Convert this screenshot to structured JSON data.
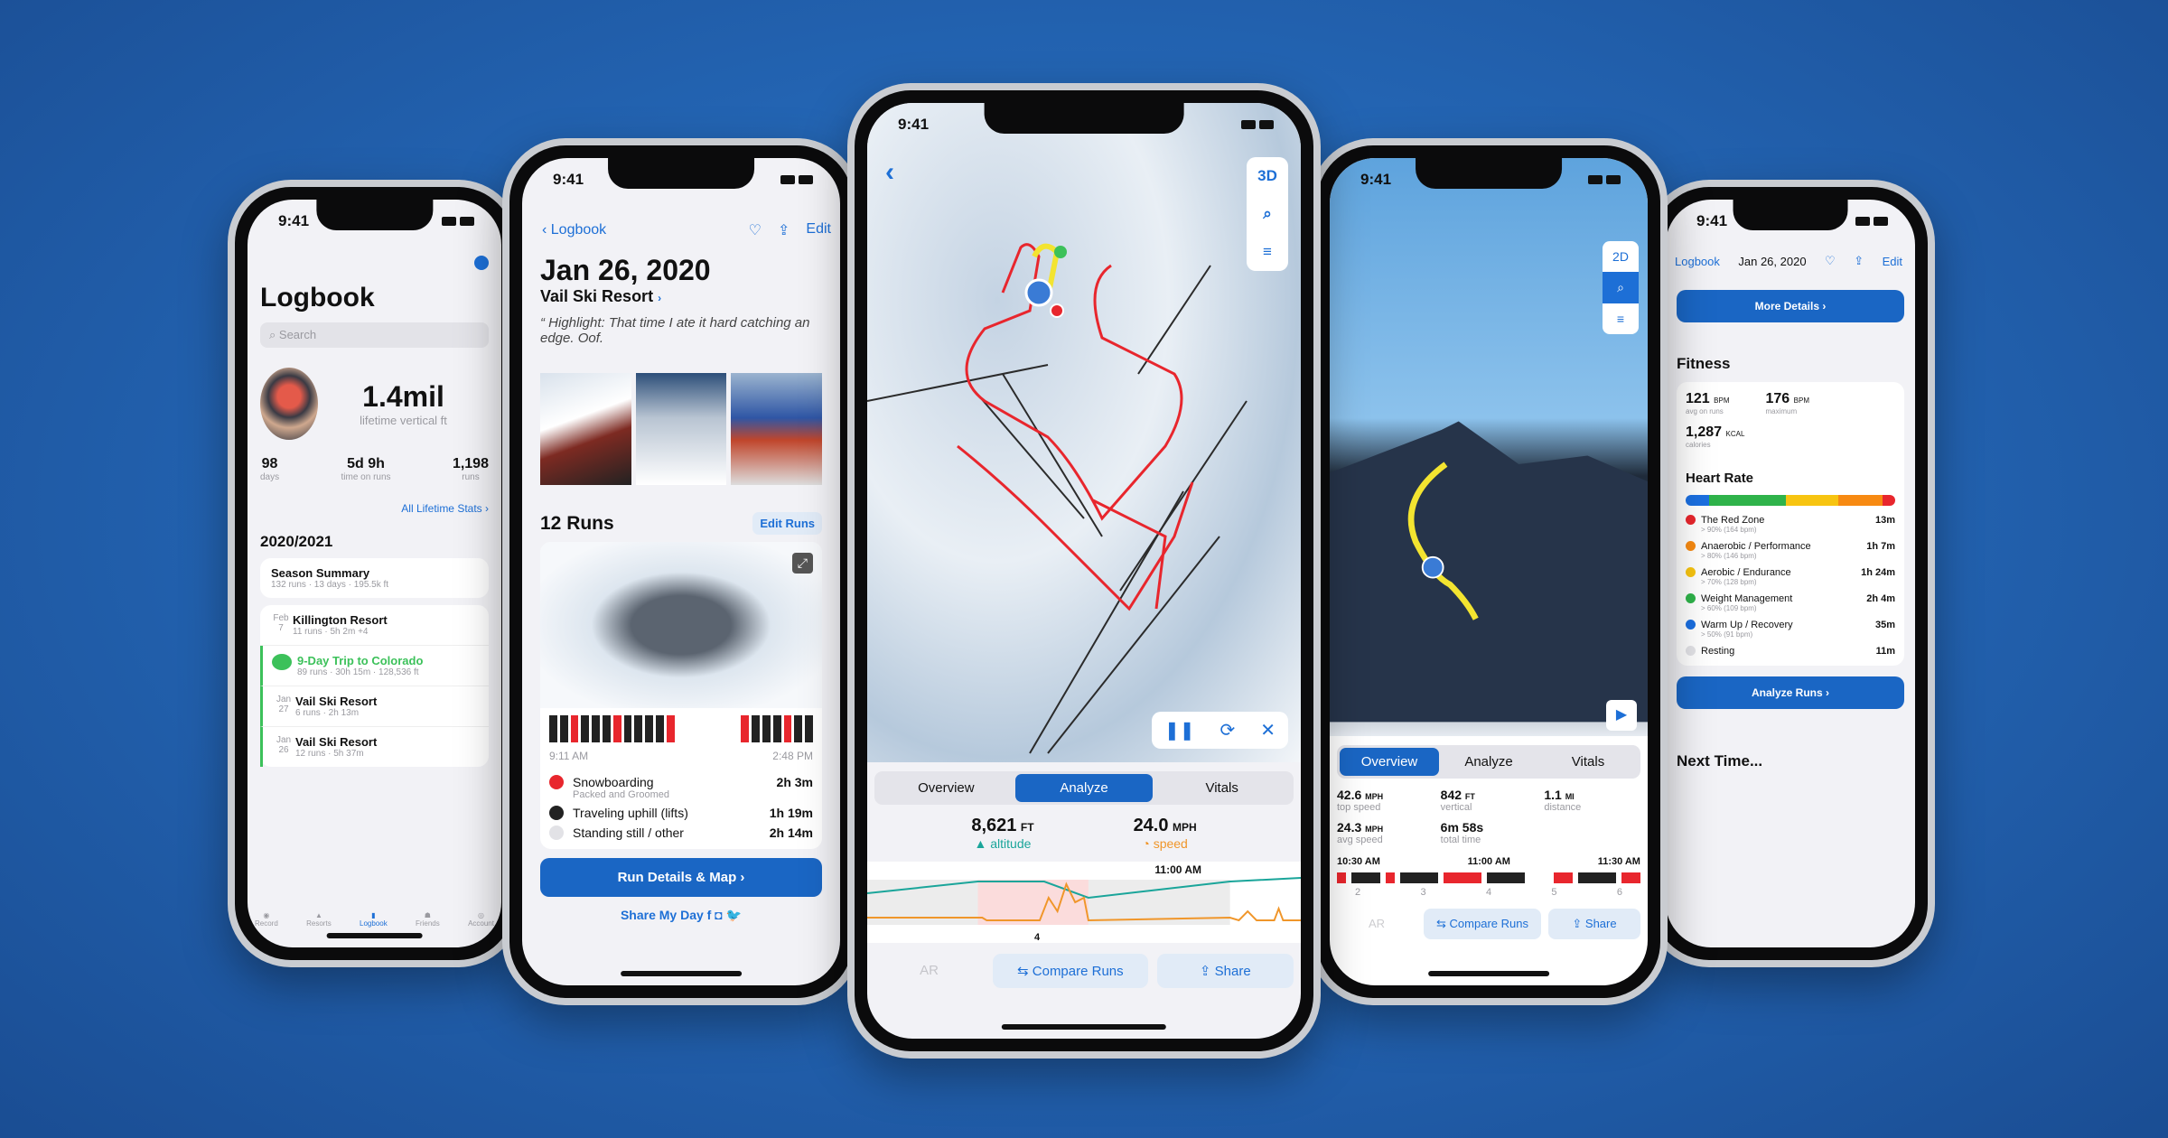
{
  "status_time": "9:41",
  "colors": {
    "accent": "#1a66c4",
    "run_red": "#e8262d",
    "altitude": "#1aa59a",
    "speed": "#f0962a",
    "trip_green": "#3cc15a"
  },
  "logbook": {
    "title": "Logbook",
    "search_placeholder": "Search",
    "lifetime_vertical": "1.4mil",
    "lifetime_vertical_label": "lifetime vertical ft",
    "stats": [
      {
        "value": "98",
        "label": "days"
      },
      {
        "value": "5d 9h",
        "label": "time on runs"
      },
      {
        "value": "1,198",
        "label": "runs"
      }
    ],
    "all_stats_link": "All Lifetime Stats ›",
    "season": "2020/2021",
    "season_summary": {
      "title": "Season Summary",
      "sub": "132 runs · 13 days · 195.5k ft"
    },
    "items": [
      {
        "month": "Feb",
        "day": "7",
        "title": "Killington Resort",
        "sub": "11 runs · 5h 2m",
        "extra": "+4"
      },
      {
        "month": "",
        "day": "",
        "title": "9-Day Trip to Colorado",
        "sub": "89 runs · 30h 15m · 128,536 ft",
        "extra": ""
      },
      {
        "month": "Jan",
        "day": "27",
        "title": "Vail Ski Resort",
        "sub": "6 runs · 2h 13m",
        "extra": ""
      },
      {
        "month": "Jan",
        "day": "26",
        "title": "Vail Ski Resort",
        "sub": "12 runs · 5h 37m",
        "extra": ""
      }
    ],
    "tabs": [
      "Record",
      "Resorts",
      "Logbook",
      "Friends",
      "Account"
    ]
  },
  "day": {
    "back": "Logbook",
    "edit": "Edit",
    "date": "Jan 26, 2020",
    "resort": "Vail Ski Resort",
    "highlight": "Highlight: That time I ate it hard catching an edge. Oof.",
    "runs_title": "12 Runs",
    "edit_runs": "Edit Runs",
    "start_time": "9:11 AM",
    "end_time": "2:48 PM",
    "activities": [
      {
        "name": "Snowboarding",
        "sub": "Packed and Groomed",
        "time": "2h 3m",
        "color": "#e8262d"
      },
      {
        "name": "Traveling uphill (lifts)",
        "sub": "",
        "time": "1h 19m",
        "color": "#222222"
      },
      {
        "name": "Standing still / other",
        "sub": "",
        "time": "2h 14m",
        "color": "#e2e2e6"
      }
    ],
    "run_details_btn": "Run Details & Map",
    "share_my_day": "Share My Day"
  },
  "map": {
    "mode_3d": "3D",
    "tabs": [
      "Overview",
      "Analyze",
      "Vitals"
    ],
    "active_tab": "Analyze",
    "altitude_value": "8,621",
    "altitude_unit": "FT",
    "altitude_label": "altitude",
    "speed_value": "24.0",
    "speed_unit": "MPH",
    "speed_label": "speed",
    "chart_time": "11:00 AM",
    "run_number": "4",
    "ar": "AR",
    "compare": "Compare Runs",
    "share": "Share"
  },
  "run3d": {
    "mode_2d": "2D",
    "tabs": [
      "Overview",
      "Analyze",
      "Vitals"
    ],
    "active_tab": "Overview",
    "stats": [
      {
        "value": "42.6",
        "unit": "MPH",
        "label": "top speed"
      },
      {
        "value": "842",
        "unit": "FT",
        "label": "vertical"
      },
      {
        "value": "1.1",
        "unit": "MI",
        "label": "distance"
      },
      {
        "value": "24.3",
        "unit": "MPH",
        "label": "avg speed"
      },
      {
        "value": "6m 58s",
        "unit": "",
        "label": "total time"
      }
    ],
    "times": [
      "10:30 AM",
      "11:00 AM",
      "11:30 AM"
    ],
    "run_numbers": [
      "2",
      "3",
      "4",
      "5",
      "6"
    ],
    "ar": "AR",
    "compare": "Compare Runs",
    "share": "Share"
  },
  "fitness": {
    "back": "Logbook",
    "date": "Jan 26, 2020",
    "edit": "Edit",
    "more_details": "More Details",
    "section": "Fitness",
    "avg_bpm": "121",
    "avg_label": "avg on runs",
    "max_bpm": "176",
    "max_label": "maximum",
    "bpm_unit": "BPM",
    "kcal": "1,287",
    "kcal_unit": "KCAL",
    "kcal_label": "calories",
    "hr_title": "Heart Rate",
    "zones": [
      {
        "name": "The Red Zone",
        "sub": "> 90% (164 bpm)",
        "time": "13m",
        "color": "#e8262d"
      },
      {
        "name": "Anaerobic / Performance",
        "sub": "> 80% (146 bpm)",
        "time": "1h 7m",
        "color": "#f78a12"
      },
      {
        "name": "Aerobic / Endurance",
        "sub": "> 70% (128 bpm)",
        "time": "1h 24m",
        "color": "#f7c411"
      },
      {
        "name": "Weight Management",
        "sub": "> 60% (109 bpm)",
        "time": "2h 4m",
        "color": "#2fb34a"
      },
      {
        "name": "Warm Up / Recovery",
        "sub": "> 50% (91 bpm)",
        "time": "35m",
        "color": "#1b6fe0"
      },
      {
        "name": "Resting",
        "sub": "",
        "time": "11m",
        "color": "#e2e2e6"
      }
    ],
    "hr_fractions": {
      "warmup": 0.11,
      "weight": 0.37,
      "aerobic": 0.25,
      "anaerobic": 0.21,
      "red": 0.06
    },
    "analyze_btn": "Analyze Runs",
    "next_time": "Next Time..."
  }
}
